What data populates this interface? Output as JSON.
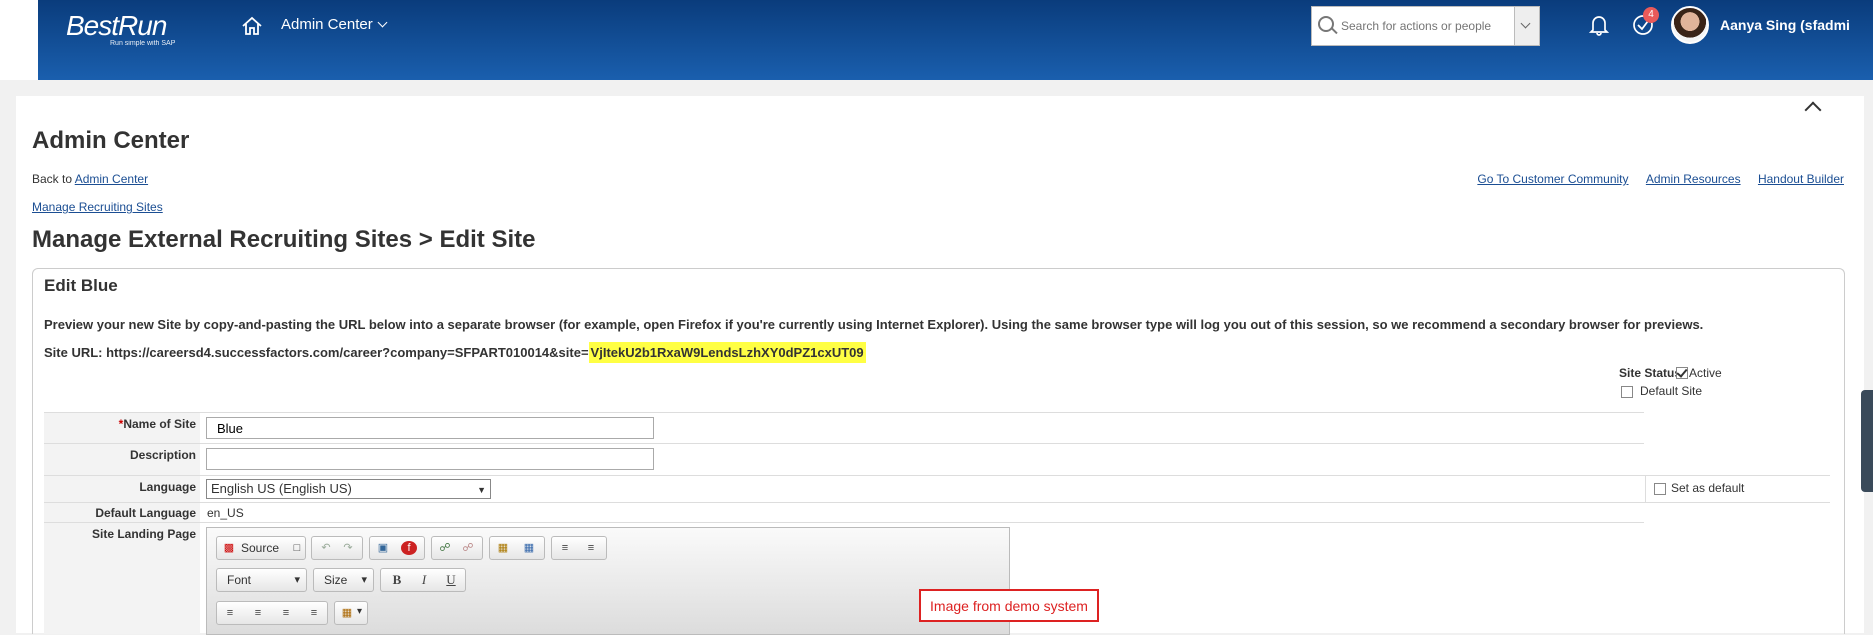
{
  "header": {
    "logo_text": "BestRun",
    "logo_tagline": "Run simple with SAP",
    "admin_menu_label": "Admin Center",
    "search_placeholder": "Search for actions or people",
    "notification_count": "4",
    "user_name": "Aanya Sing (sfadmi"
  },
  "page": {
    "title": "Admin Center",
    "back_prefix": "Back to",
    "back_link": "Admin Center",
    "top_links": [
      "Go To Customer Community",
      "Admin Resources",
      "Handout Builder"
    ],
    "manage_link": "Manage Recruiting Sites",
    "section_title": "Manage External Recruiting Sites > Edit Site"
  },
  "edit": {
    "title": "Edit Blue",
    "preview_text": "Preview your new Site by copy-and-pasting the URL below into a separate browser (for example, open Firefox if you're currently using Internet Explorer). Using the same browser type will log you out of this session, so we recommend a secondary browser for previews.",
    "site_url_label": "Site URL: https://careersd4.successfactors.com/career?company=SFPART010014&site=",
    "site_url_highlight": "VjItekU2b1RxaW9LendsLzhXY0dPZ1cxUT09",
    "site_status_label": "Site Status",
    "active_label": "Active",
    "active_checked": true,
    "default_site_label": "Default Site",
    "default_site_checked": false,
    "fields": {
      "name_label": "Name of Site",
      "name_required_mark": "*",
      "name_value": "Blue",
      "description_label": "Description",
      "description_value": "",
      "language_label": "Language",
      "language_value": "English US (English US)",
      "set_default_label": "Set as default",
      "default_language_label": "Default Language",
      "default_language_value": "en_US",
      "landing_page_label": "Site Landing Page"
    },
    "editor": {
      "source_label": "Source",
      "font_label": "Font",
      "size_label": "Size",
      "bold": "B",
      "italic": "I",
      "underline": "U"
    }
  },
  "watermark": "Image from demo system"
}
